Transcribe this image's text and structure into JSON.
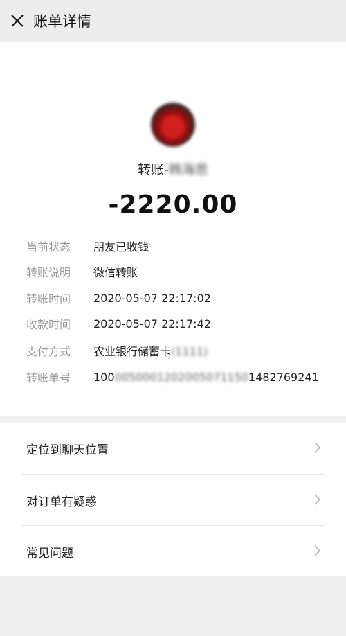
{
  "nav": {
    "title": "账单详情",
    "close_icon": "close-icon"
  },
  "bill": {
    "payee_prefix": "转账-",
    "payee_name": "韩海思",
    "amount": "-2220.00"
  },
  "details": [
    {
      "label": "当前状态",
      "value": "朋友已收钱"
    },
    {
      "label": "转账说明",
      "value": "微信转账"
    },
    {
      "label": "转账时间",
      "value": "2020-05-07 22:17:02"
    },
    {
      "label": "收款时间",
      "value": "2020-05-07 22:17:42"
    },
    {
      "label": "支付方式",
      "value_main": "农业银行储蓄卡",
      "value_blur": "(1111)"
    },
    {
      "label": "转账单号",
      "value_start": "100",
      "value_blur": "0050001202005071150",
      "value_end": "1482769241"
    }
  ],
  "menu": [
    {
      "label": "定位到聊天位置",
      "icon": "chevron-right-icon"
    },
    {
      "label": "对订单有疑惑",
      "icon": "chevron-right-icon"
    },
    {
      "label": "常见问题",
      "icon": "chevron-right-icon"
    }
  ],
  "colors": {
    "page_bg": "#efefef",
    "card_bg": "#ffffff",
    "label": "#9a9a9a",
    "text": "#222222"
  }
}
